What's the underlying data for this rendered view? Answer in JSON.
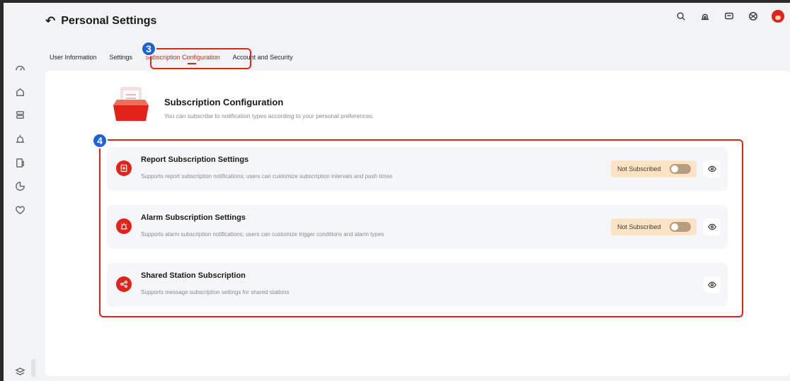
{
  "header": {
    "title": "Personal Settings"
  },
  "tabs": [
    {
      "label": "User Information"
    },
    {
      "label": "Settings"
    },
    {
      "label": "Subscription Configuration",
      "active": true
    },
    {
      "label": "Account and Security"
    }
  ],
  "badges": {
    "tab_step": "3",
    "items_step": "4"
  },
  "intro": {
    "title": "Subscription Configuration",
    "description": "You can subscribe to notification types according to your personal preferences."
  },
  "subscriptions": [
    {
      "title": "Report Subscription Settings",
      "description": "Supports report subscription notifications; users can customize subscription intervals and push times",
      "status": "Not Subscribed",
      "icon": "report-icon"
    },
    {
      "title": "Alarm Subscription Settings",
      "description": "Supports alarm subscription notifications; users can customize trigger conditions and alarm types",
      "status": "Not Subscribed",
      "icon": "alarm-icon"
    },
    {
      "title": "Shared Station Subscription",
      "description": "Supports message subscription settings for shared stations",
      "icon": "share-icon"
    }
  ],
  "colors": {
    "accent": "#e2231a",
    "badge": "#1e63d6",
    "status_bg": "#fbe3c3"
  }
}
